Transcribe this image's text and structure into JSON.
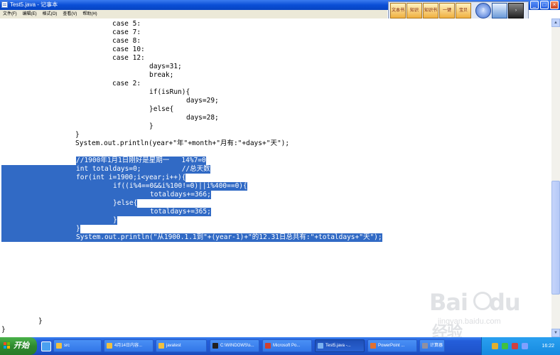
{
  "window": {
    "title": "Test5.java - 记事本",
    "buttons": {
      "minimize": "_",
      "maximize": "□",
      "close": "×"
    }
  },
  "toolbar": {
    "items": [
      "文本书",
      "知识",
      "知识书",
      "一键",
      "宝贝",
      "",
      "",
      "",
      ""
    ],
    "icons": [
      "book-icon",
      "knowledge-icon",
      "knowledge-book-icon",
      "one-key-icon",
      "treasure-icon",
      "help-globe-icon",
      "monitor-icon",
      "terminal-icon"
    ]
  },
  "menu": [
    "文件(F)",
    "编辑(E)",
    "格式(O)",
    "查看(V)",
    "帮助(H)"
  ],
  "code": {
    "plain_lines": [
      "\t\tcase 5:",
      "\t\tcase 7:",
      "\t\tcase 8:",
      "\t\tcase 10:",
      "\t\tcase 12:",
      "\t\t\tdays=31;",
      "\t\t\tbreak;",
      "\t\tcase 2:",
      "\t\t\tif(isRun){",
      "\t\t\t\tdays=29;",
      "\t\t\t}else{",
      "\t\t\t\tdays=28;",
      "\t\t\t}",
      "\t}",
      "\tSystem.out.println(year+\"年\"+month+\"月有:\"+days+\"天\");",
      ""
    ],
    "selected_lines": [
      "//1900年1月1日刚好是星期一   14%7=0",
      "int totaldays=0;          //总天数",
      "for(int i=1900;i<year;i++){",
      "\tif((i%4==0&&i%100!=0)||i%400==0){",
      "\t\ttotaldays+=366;",
      "\t}else{",
      "\t\ttotaldays+=365;",
      "\t}",
      "}",
      "System.out.println(\"从1900.1.1到\"+(year-1)+\"的12.31日总共有:\"+totaldays+\"天\");"
    ],
    "tail_lines": [
      "}",
      "}"
    ]
  },
  "watermark": {
    "brand": "Bai",
    "brand2": "du",
    "suffix": "经验",
    "url": "jingyan.baidu.com"
  },
  "taskbar": {
    "start": "开始",
    "tasks": [
      "src",
      "4月14日内容...",
      "javatest",
      "C:\\WINDOWS\\s...",
      "Microsoft Po...",
      "Test5.java -...",
      "PowerPoint ...",
      "计算器"
    ],
    "active_task": 5,
    "clock": "16:22"
  },
  "colors": {
    "selection": "#316ac5",
    "titlebar": "#0a4fd6",
    "taskbar": "#245edb",
    "start": "#2e8a2e"
  }
}
